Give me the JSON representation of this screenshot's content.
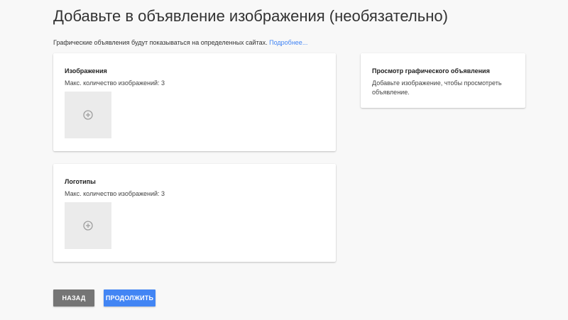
{
  "header": {
    "title": "Добавьте в объявление изображения (необязательно)",
    "subtitle_text": "Графические объявления будут показываться на определенных сайтах.",
    "learn_more_link": "Подробнее..."
  },
  "images_card": {
    "title": "Изображения",
    "limit_text": "Макс. количество изображений: 3",
    "upload_icon": "add-circle-icon"
  },
  "logos_card": {
    "title": "Логотипы",
    "limit_text": "Макс. количество изображений: 3",
    "upload_icon": "add-circle-icon"
  },
  "preview_card": {
    "title": "Просмотр графического объявления",
    "text": "Добавьте изображение, чтобы просмотреть объявление."
  },
  "actions": {
    "back_label": "НАЗАД",
    "continue_label": "ПРОДОЛЖИТЬ"
  },
  "colors": {
    "background": "#f8f8f8",
    "link": "#4285f4",
    "primary_button": "#4285f4",
    "secondary_button": "#757575",
    "upload_tile": "#ebebeb"
  }
}
